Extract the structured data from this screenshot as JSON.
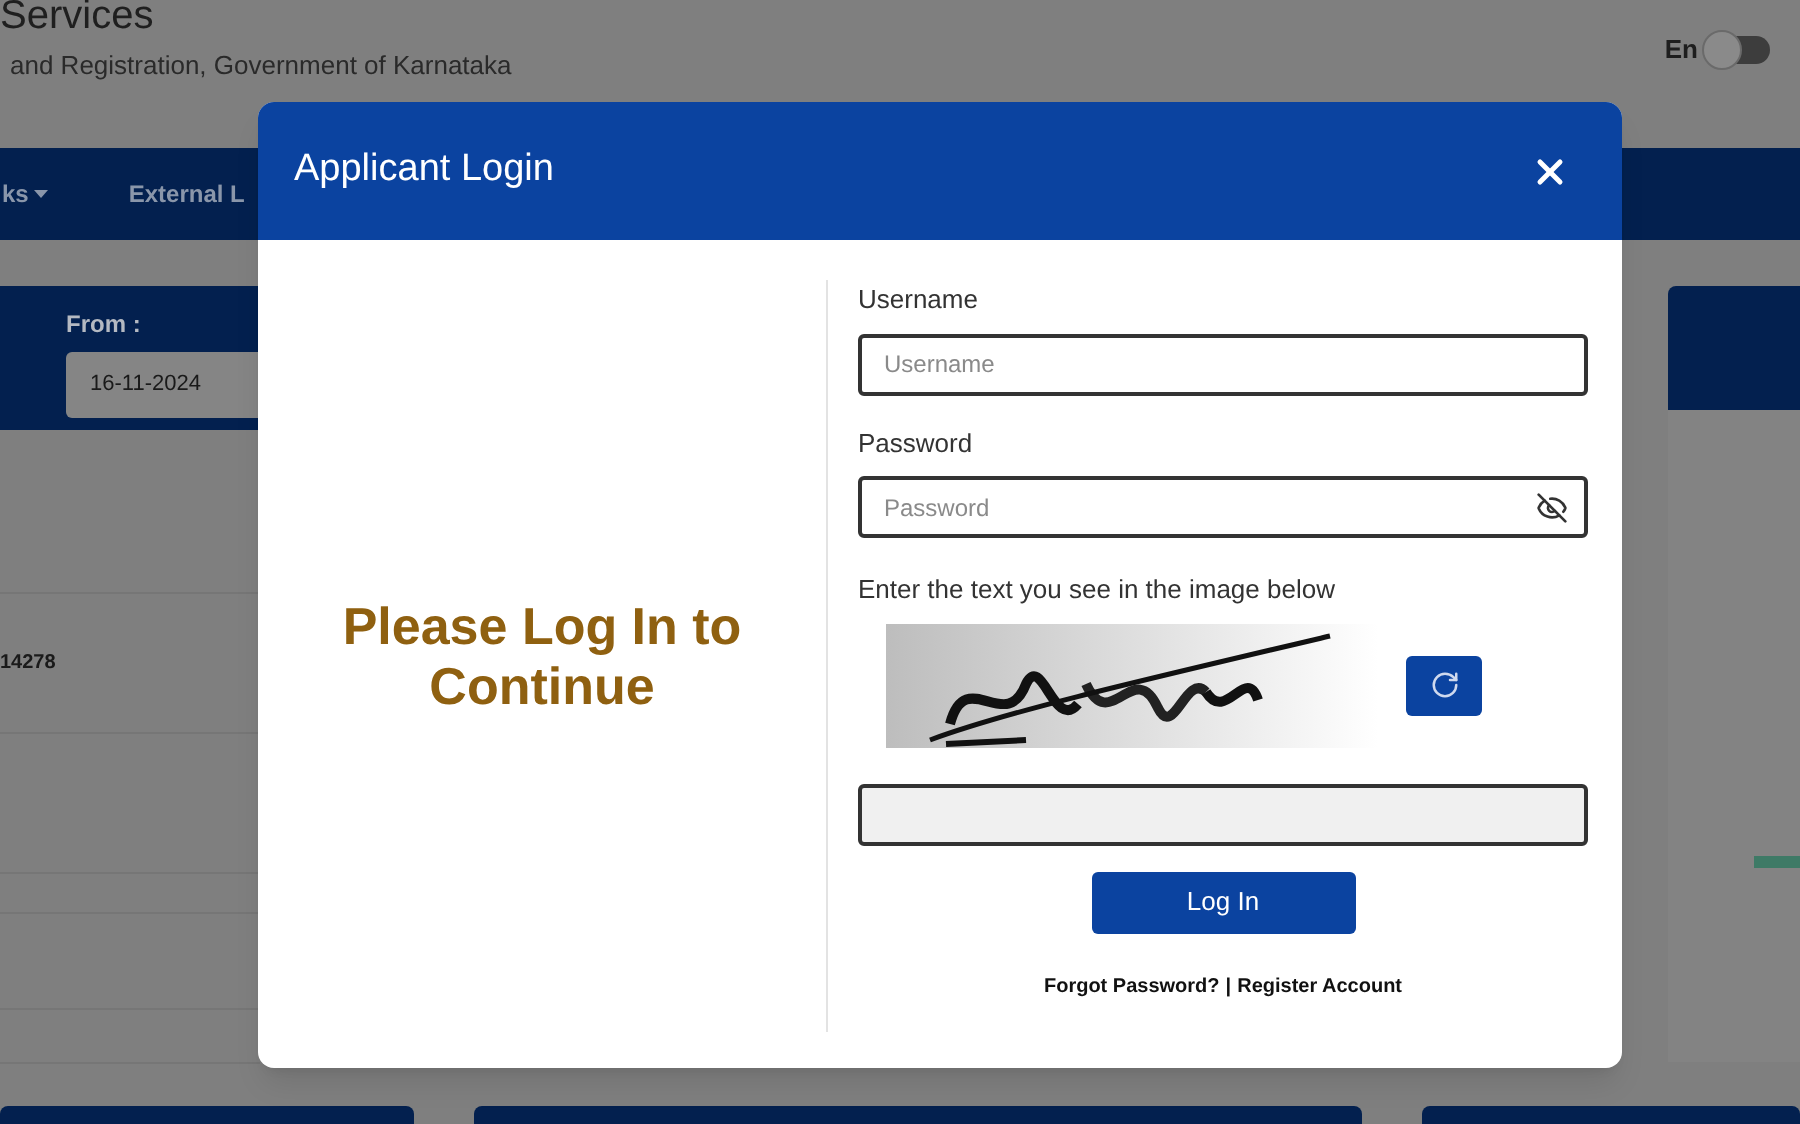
{
  "header": {
    "title": "Services",
    "subtitle": "and Registration, Government of Karnataka"
  },
  "language": {
    "label": "En",
    "on": false
  },
  "nav": [
    {
      "label": "ks",
      "dropdown": true
    },
    {
      "label": "External L",
      "dropdown": false
    }
  ],
  "filter": {
    "label": "From :",
    "value": "16-11-2024"
  },
  "list_cell": "14278",
  "modal": {
    "title": "Applicant Login",
    "message": "Please Log In to Continue",
    "username": {
      "label": "Username",
      "placeholder": "Username"
    },
    "password": {
      "label": "Password",
      "placeholder": "Password"
    },
    "captcha_prompt": "Enter the text you see in the image below",
    "submit": "Log In",
    "links": [
      "Forgot Password?",
      "Register Account"
    ],
    "link_separator": "|"
  }
}
